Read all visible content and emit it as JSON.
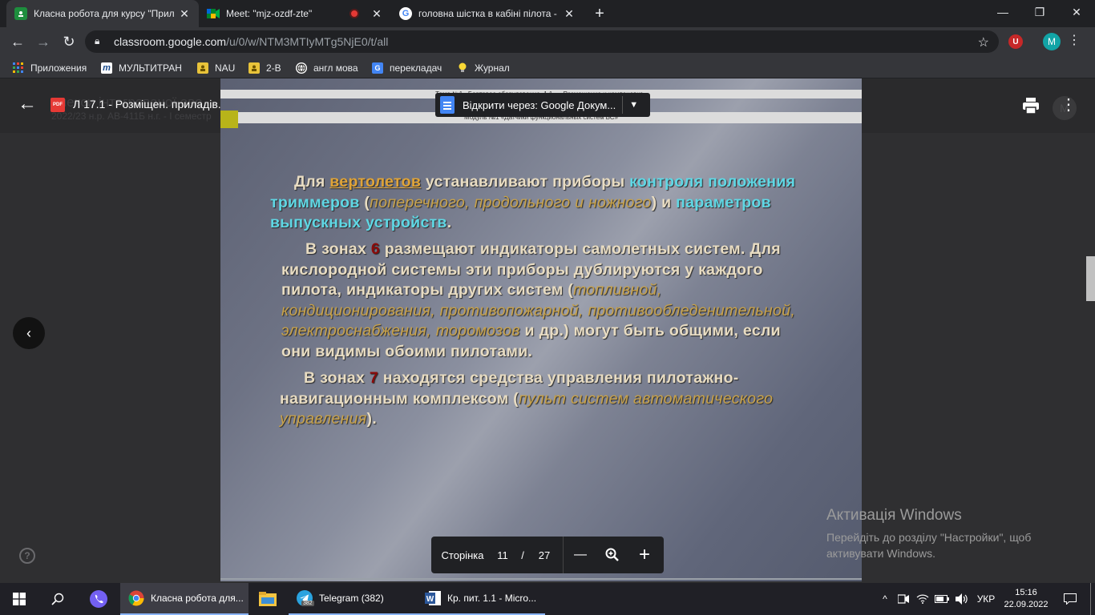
{
  "tabs": [
    {
      "title": "Класна робота для курсу \"Прил",
      "icon": "classroom-icon",
      "active": true
    },
    {
      "title": "Meet: \"mjz-ozdf-zte\"",
      "icon": "meet-icon",
      "active": false
    },
    {
      "title": "головна шістка в кабіні пілота -",
      "icon": "google-icon",
      "active": false
    }
  ],
  "new_tab_label": "+",
  "address": {
    "host": "classroom.google.com",
    "path": "/u/0/w/NTM3MTIyMTg5NjE0/t/all"
  },
  "profile_initial": "M",
  "extension_letter": "U",
  "bookmarks": [
    {
      "label": "Приложения",
      "icon": "apps-grid-icon"
    },
    {
      "label": "МУЛЬТИТРАН",
      "icon": "multitran-icon"
    },
    {
      "label": "NAU",
      "icon": "folder-avatar-icon"
    },
    {
      "label": "2-В",
      "icon": "folder-avatar-icon"
    },
    {
      "label": "англ мова",
      "icon": "globe-icon"
    },
    {
      "label": "переклaдач",
      "icon": "translate-icon"
    },
    {
      "label": "Журнал",
      "icon": "bulb-icon"
    }
  ],
  "viewer": {
    "file_name": "Л 17.1 - Розміщен. приладів.pdf",
    "file_badge": "PDF",
    "bg_title": "плекси інтегрованої аво...",
    "bg_subtitle": "2022/23 н.р. АВ-411Б н.г. - I семестр",
    "open_with": "Відкрити через: Google Докум...",
    "bg_avatar": "M"
  },
  "document": {
    "header_top": "Тема №1 «Бортовое оборудование. 1.1.» «Размещение и компоновка»",
    "header_bottom": "Модуль №1 «Датчики функциональных систем ВС»",
    "p1": [
      {
        "t": "Для ",
        "c": ""
      },
      {
        "t": "вертолетов",
        "c": "link"
      },
      {
        "t": " устанавливают приборы ",
        "c": ""
      },
      {
        "t": "контроля положения триммеров",
        "c": "cyan"
      },
      {
        "t": " (",
        "c": ""
      },
      {
        "t": "поперечного, продольного и ножного",
        "c": "gold"
      },
      {
        "t": ") и ",
        "c": ""
      },
      {
        "t": "параметров выпускных устройств",
        "c": "cyan"
      },
      {
        "t": ".",
        "c": ""
      }
    ],
    "p2": [
      {
        "t": "В зонах ",
        "c": ""
      },
      {
        "t": "6",
        "c": "red"
      },
      {
        "t": " размещают индикаторы самолетных систем. Для кислородной системы эти приборы дублируются у каждого пилота, индикаторы других систем (",
        "c": ""
      },
      {
        "t": "топливной, кондиционирования, противопожарной, противообледенительной, электроснабжения, торомозов",
        "c": "gold"
      },
      {
        "t": " и др.) могут быть общими, если они видимы обоими пилотами.",
        "c": ""
      }
    ],
    "p3": [
      {
        "t": "В зонах ",
        "c": ""
      },
      {
        "t": "7",
        "c": "red"
      },
      {
        "t": "  находятся средства управления пилотажно-навигационным комплексом (",
        "c": ""
      },
      {
        "t": "пульт систем автоматического управления",
        "c": "gold"
      },
      {
        "t": ").",
        "c": ""
      }
    ]
  },
  "pagebar": {
    "label": "Сторінка",
    "current": "11",
    "separator": "/",
    "total": "27",
    "zoom_out": "—",
    "zoom_in": "+"
  },
  "activation": {
    "title": "Активація Windows",
    "line1": "Перейдіть до розділу \"Настройки\", щоб",
    "line2": "активувати Windows."
  },
  "taskbar": {
    "items": [
      {
        "label": "Класна робота для...",
        "icon": "chrome-icon"
      },
      {
        "label": "Telegram (382)",
        "icon": "telegram-icon",
        "badge": "382"
      },
      {
        "label": "Кр. пит. 1.1 - Micro...",
        "icon": "word-icon"
      }
    ],
    "lang": "УКР",
    "time": "15:16",
    "date": "22.09.2022"
  },
  "colors": {
    "accent": "#8ab4f8",
    "chrome_dark": "#202124",
    "chrome_mid": "#35363a",
    "profile": "#12a4a6"
  }
}
